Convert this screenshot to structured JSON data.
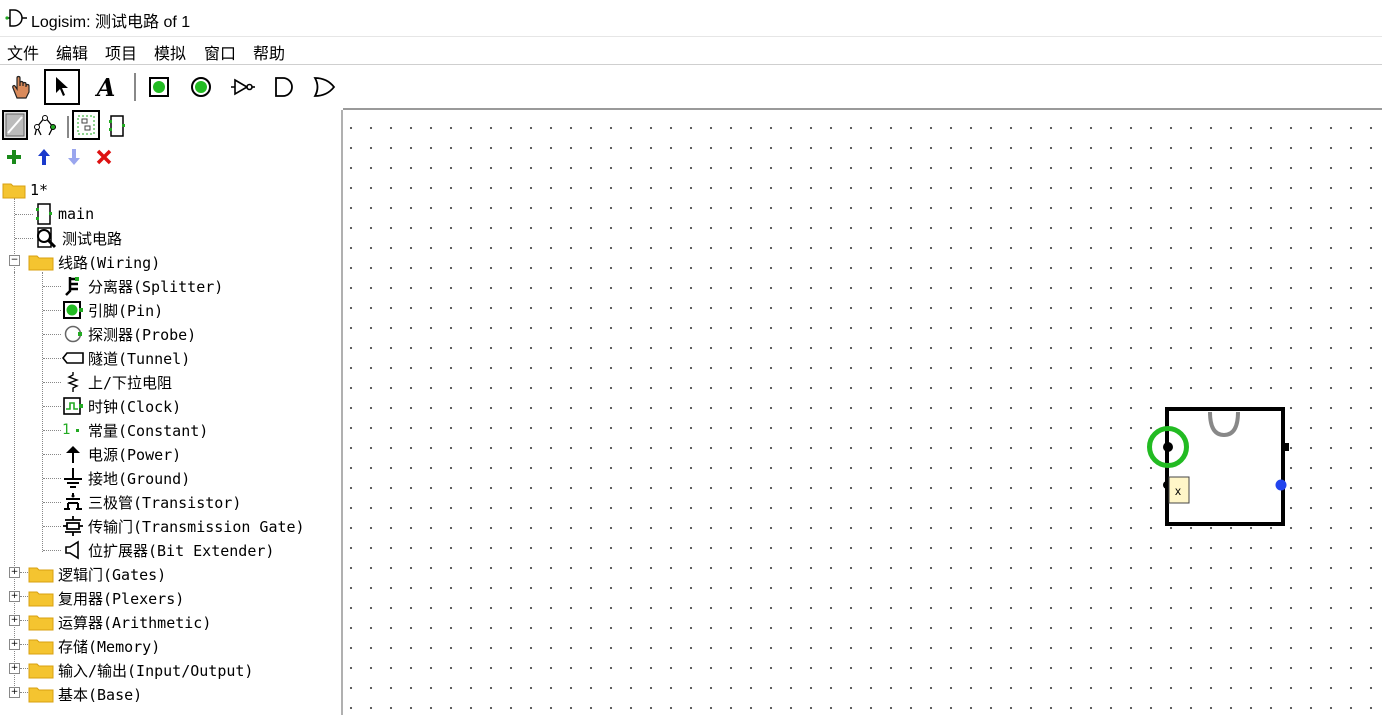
{
  "window": {
    "title": "Logisim: 测试电路 of 1"
  },
  "menu": [
    "文件",
    "编辑",
    "项目",
    "模拟",
    "窗口",
    "帮助"
  ],
  "toolbar": {
    "tools": [
      "poke-tool",
      "select-tool",
      "text-tool",
      "input-pin",
      "output-pin",
      "not-gate",
      "and-gate",
      "or-gate"
    ],
    "text_tool_glyph": "A"
  },
  "tree": {
    "project": "1*",
    "circuits": [
      "main",
      "测试电路"
    ],
    "wiring_folder": "线路(Wiring)",
    "wiring_items": [
      "分离器(Splitter)",
      "引脚(Pin)",
      "探测器(Probe)",
      "隧道(Tunnel)",
      "上/下拉电阻",
      "时钟(Clock)",
      "常量(Constant)",
      "电源(Power)",
      "接地(Ground)",
      "三极管(Transistor)",
      "传输门(Transmission Gate)",
      "位扩展器(Bit Extender)"
    ],
    "constant_prefix": "1",
    "folders": [
      "逻辑门(Gates)",
      "复用器(Plexers)",
      "运算器(Arithmetic)",
      "存储(Memory)",
      "输入/输出(Input/Output)",
      "基本(Base)"
    ]
  },
  "canvas": {
    "subcircuit_label": "x",
    "colors": {
      "selection": "#22bb22",
      "wire_blue": "#2244ee",
      "pin_dark": "#000000"
    }
  }
}
